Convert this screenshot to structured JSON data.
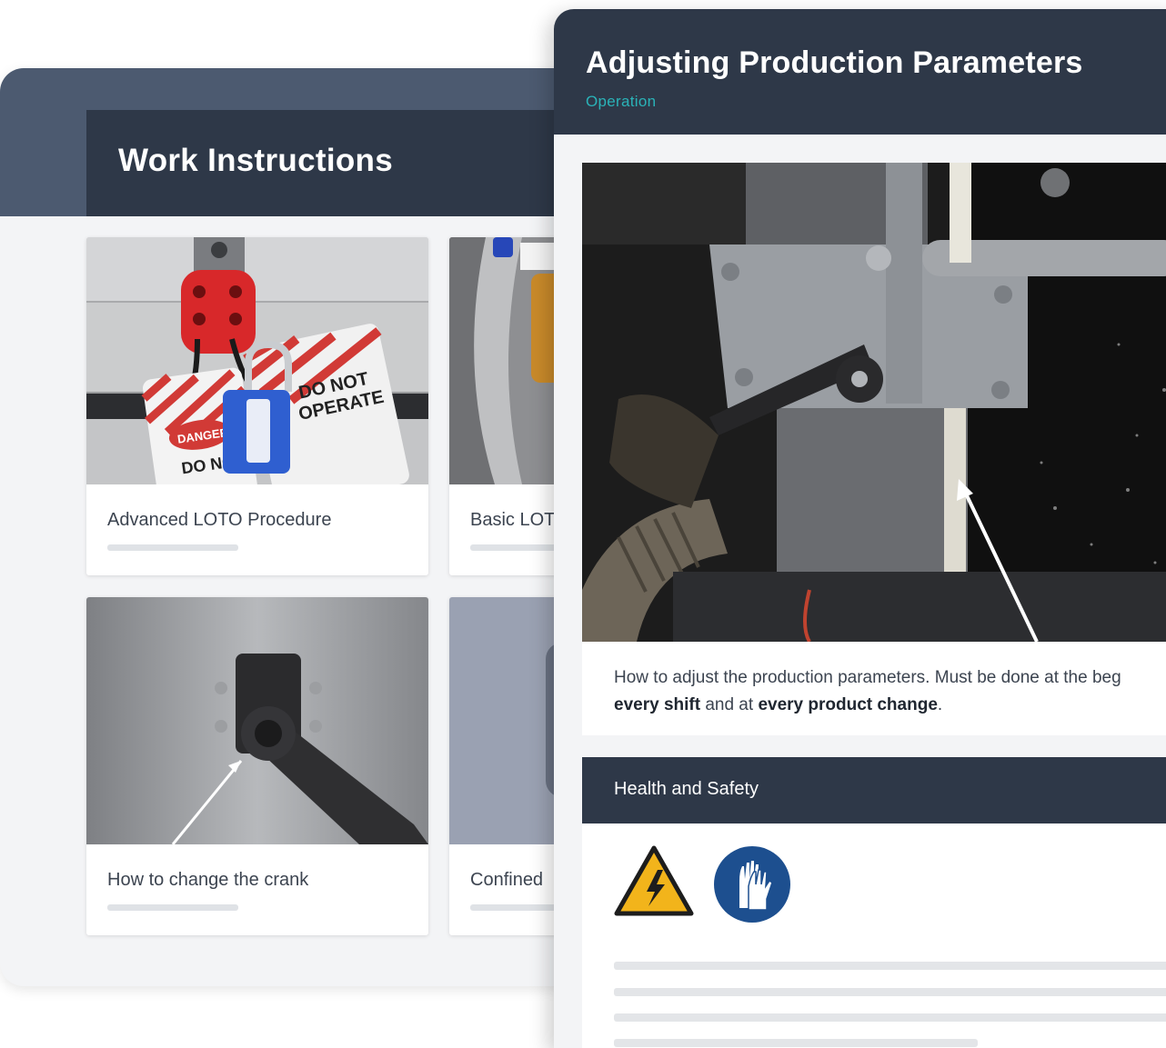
{
  "work_instructions": {
    "title": "Work Instructions",
    "cards": [
      {
        "label": "Advanced LOTO Procedure"
      },
      {
        "label": "Basic LOT"
      },
      {
        "label": "How to change the crank"
      },
      {
        "label": "Confined"
      }
    ]
  },
  "detail": {
    "title": "Adjusting Production Parameters",
    "category": "Operation",
    "step_text_1": "How to adjust the production parameters. Must be done at the beg",
    "step_text_2a": "every shift",
    "step_text_2b": " and at ",
    "step_text_2c": "every product change",
    "step_text_2d": ".",
    "health_safety": {
      "title": "Health and Safety",
      "icons": [
        "electrical-hazard-warning-icon",
        "wear-gloves-icon"
      ]
    }
  },
  "colors": {
    "header_dark": "#2e3848",
    "header_slate": "#4c5a70",
    "accent_teal": "#2ab3b8",
    "panel_bg": "#f3f4f6",
    "warning_yellow": "#f2b41b",
    "mandatory_blue": "#1d4f8f"
  },
  "photo_labels": {
    "danger": "DANGER",
    "do_not": "DO NOT",
    "operate": "OPERATE"
  }
}
